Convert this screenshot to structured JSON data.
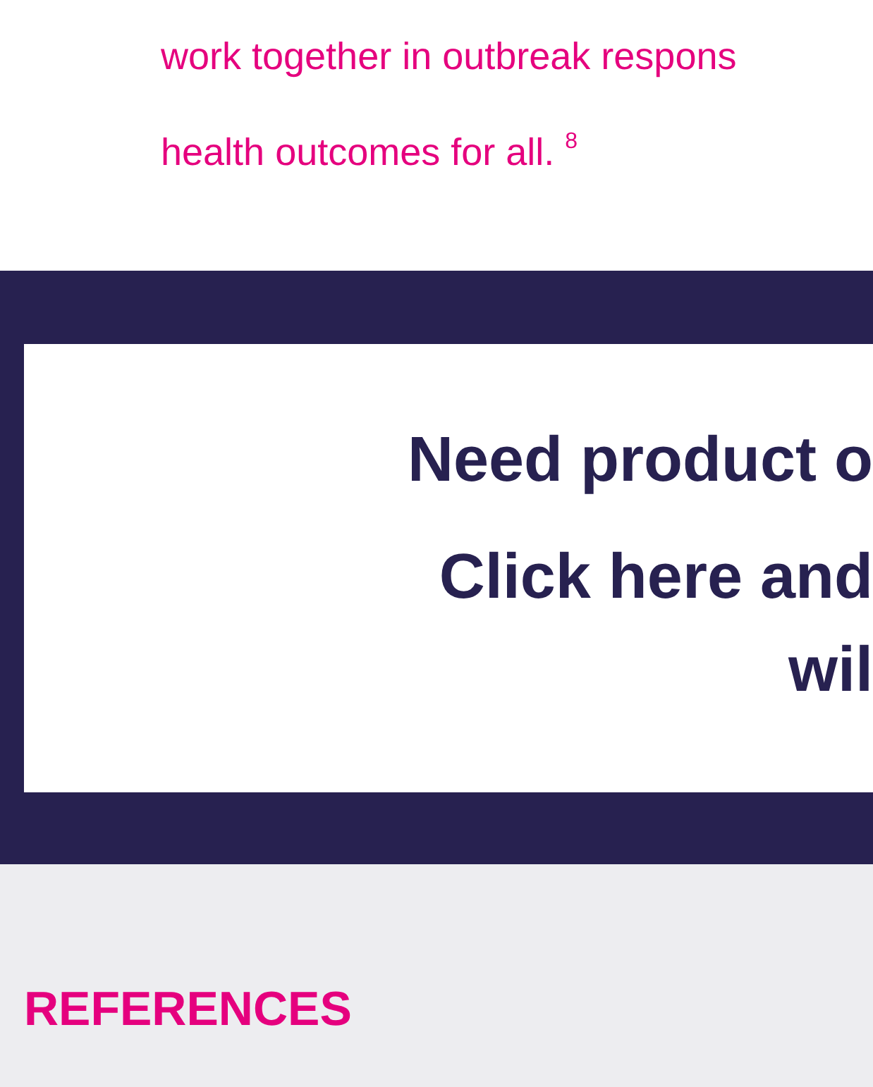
{
  "intro": {
    "lines": [
      "work together in outbreak respons",
      "health outcomes for all. $^{8}$"
    ]
  },
  "callout": {
    "heading": "Need product o",
    "link_lines": [
      "Click here and",
      "wil"
    ]
  },
  "references": {
    "title": "REFERENCES"
  }
}
